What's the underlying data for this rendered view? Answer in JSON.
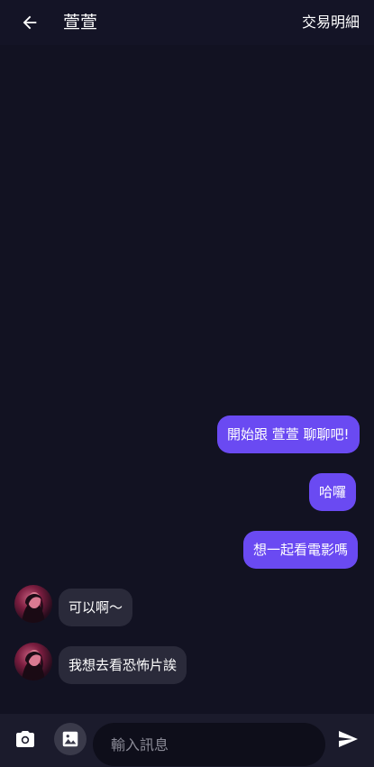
{
  "header": {
    "back_icon": "arrow-left-icon",
    "title": "萱萱",
    "transaction_link": "交易明細"
  },
  "messages": [
    {
      "direction": "outgoing",
      "text": "開始跟 萱萱 聊聊吧!"
    },
    {
      "direction": "outgoing",
      "text": "哈囉"
    },
    {
      "direction": "outgoing",
      "text": "想一起看電影嗎"
    },
    {
      "direction": "incoming",
      "text": "可以啊～",
      "avatar": "avatar"
    },
    {
      "direction": "incoming",
      "text": "我想去看恐怖片誒",
      "avatar": "avatar"
    }
  ],
  "composer": {
    "camera_icon": "camera-icon",
    "image_icon": "image-icon",
    "placeholder": "輸入訊息",
    "value": "",
    "send_icon": "send-icon"
  },
  "colors": {
    "background": "#121222",
    "outgoing_bubble": "#6a4af2",
    "incoming_bubble": "#2a2a3a",
    "composer_bar": "#1b1b2c"
  }
}
